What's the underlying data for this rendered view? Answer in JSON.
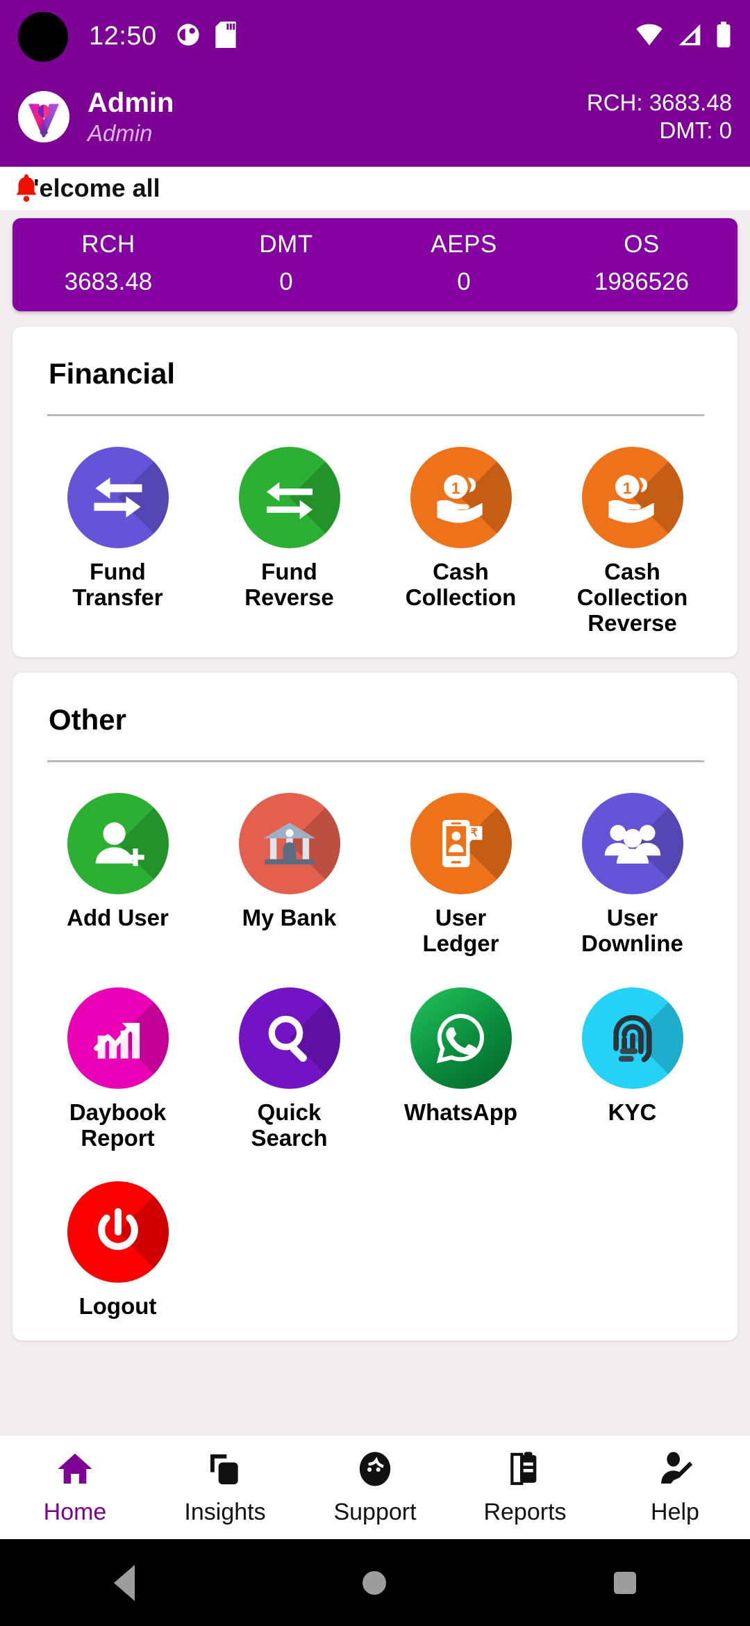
{
  "statusbar": {
    "time": "12:50",
    "icons_left": [
      "ringer-icon",
      "sd-card-icon"
    ],
    "icons_right": [
      "wifi-icon",
      "signal-icon",
      "battery-icon"
    ]
  },
  "appbar": {
    "logo_icon": "app-logo-v",
    "user_name": "Admin",
    "user_role": "Admin",
    "balance_rch": "RCH: 3683.48",
    "balance_dmt": "DMT: 0",
    "brand_color": "#7d0094"
  },
  "ticker": {
    "icon": "bell-icon",
    "text": "'elcome all"
  },
  "stats": {
    "items": [
      {
        "label": "RCH",
        "value": "3683.48"
      },
      {
        "label": "DMT",
        "value": "0"
      },
      {
        "label": "AEPS",
        "value": "0"
      },
      {
        "label": "OS",
        "value": "1986526"
      }
    ]
  },
  "financial": {
    "title": "Financial",
    "items": [
      {
        "label": "Fund Transfer",
        "icon": "fund-transfer-icon",
        "color": "#6654d8"
      },
      {
        "label": "Fund Reverse",
        "icon": "fund-reverse-icon",
        "color": "#2cb034"
      },
      {
        "label": "Cash Collection",
        "icon": "cash-collection-icon",
        "color": "#ed7219"
      },
      {
        "label": "Cash Collection Reverse",
        "icon": "cash-collection-reverse-icon",
        "color": "#ed7219"
      }
    ]
  },
  "other": {
    "title": "Other",
    "items": [
      {
        "label": "Add User",
        "icon": "add-user-icon",
        "color": "#2cb034"
      },
      {
        "label": "My Bank",
        "icon": "my-bank-icon",
        "color": "#e2604d"
      },
      {
        "label": "User Ledger",
        "icon": "user-ledger-icon",
        "color": "#ed7219"
      },
      {
        "label": "User Downline",
        "icon": "user-downline-icon",
        "color": "#6654d8"
      },
      {
        "label": "Daybook Report",
        "icon": "daybook-report-icon",
        "color": "#ea00b4"
      },
      {
        "label": "Quick Search",
        "icon": "quick-search-icon",
        "color": "#7214c4"
      },
      {
        "label": "WhatsApp",
        "icon": "whatsapp-icon",
        "color": "#05a44a"
      },
      {
        "label": "KYC",
        "icon": "kyc-fingerprint-icon",
        "color": "#25d2f5"
      },
      {
        "label": "Logout",
        "icon": "logout-power-icon",
        "color": "#fa0000"
      }
    ]
  },
  "bottomnav": {
    "items": [
      {
        "label": "Home",
        "icon": "home-icon",
        "active": true
      },
      {
        "label": "Insights",
        "icon": "insights-icon",
        "active": false
      },
      {
        "label": "Support",
        "icon": "support-icon",
        "active": false
      },
      {
        "label": "Reports",
        "icon": "reports-icon",
        "active": false
      },
      {
        "label": "Help",
        "icon": "help-icon",
        "active": false
      }
    ],
    "active_color": "#7d0094"
  },
  "androidnav": {
    "items": [
      "back-button",
      "home-button",
      "recents-button"
    ]
  }
}
